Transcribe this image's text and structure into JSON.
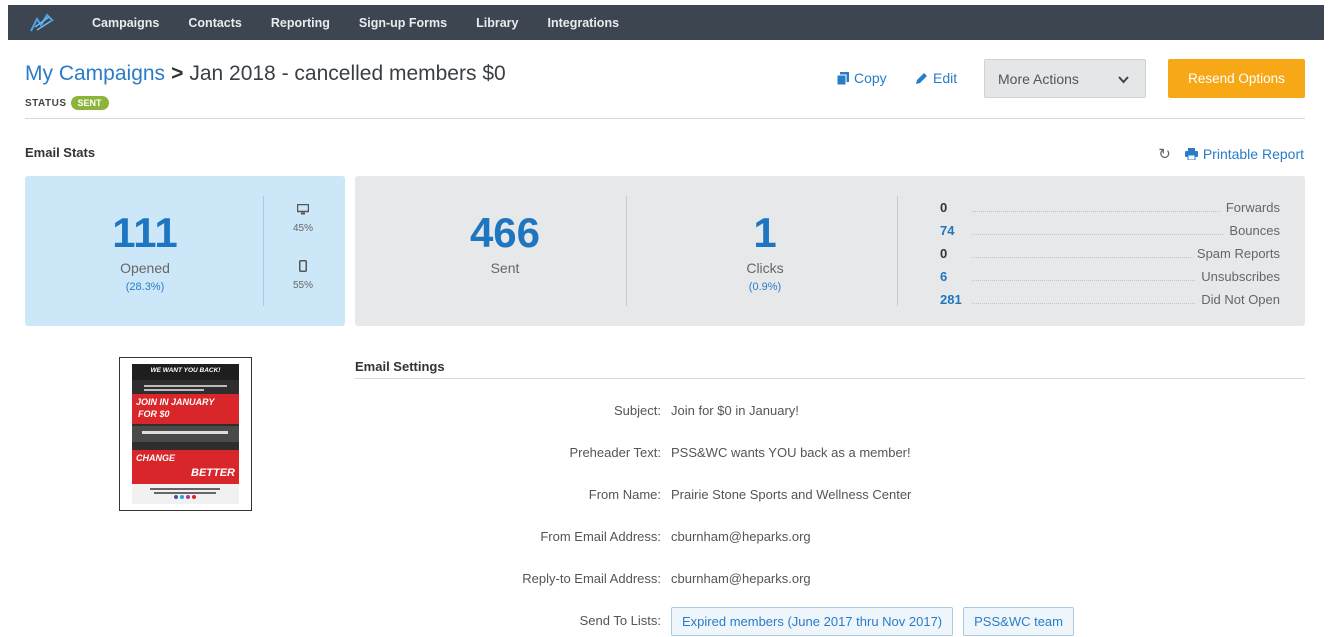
{
  "nav": {
    "items": [
      "Campaigns",
      "Contacts",
      "Reporting",
      "Sign-up Forms",
      "Library",
      "Integrations"
    ]
  },
  "header": {
    "breadcrumb": "My Campaigns",
    "separator": ">",
    "title": "Jan 2018 - cancelled members $0",
    "status_label": "STATUS",
    "status_value": "SENT",
    "copy_label": "Copy",
    "edit_label": "Edit",
    "more_actions_label": "More Actions",
    "resend_label": "Resend Options"
  },
  "stats": {
    "section_title": "Email Stats",
    "printable_label": "Printable Report",
    "opened": {
      "value": "111",
      "label": "Opened",
      "pct": "(28.3%)"
    },
    "devices": {
      "desktop_pct": "45%",
      "mobile_pct": "55%"
    },
    "sent": {
      "value": "466",
      "label": "Sent"
    },
    "clicks": {
      "value": "1",
      "label": "Clicks",
      "pct": "(0.9%)"
    },
    "breakdown": [
      {
        "value": "0",
        "label": "Forwards"
      },
      {
        "value": "74",
        "label": "Bounces"
      },
      {
        "value": "0",
        "label": "Spam Reports"
      },
      {
        "value": "6",
        "label": "Unsubscribes"
      },
      {
        "value": "281",
        "label": "Did Not Open"
      }
    ]
  },
  "thumbnail": {
    "line1": "WE WANT YOU BACK!",
    "line2": "JOIN IN JANUARY",
    "line3": "FOR $0",
    "line4": "CHANGE",
    "line5": "BETTER"
  },
  "settings": {
    "title": "Email Settings",
    "subject_key": "Subject:",
    "subject_val": "Join for $0 in January!",
    "preheader_key": "Preheader Text:",
    "preheader_val": "PSS&WC wants YOU back as a member!",
    "fromname_key": "From Name:",
    "fromname_val": "Prairie Stone Sports and Wellness Center",
    "fromemail_key": "From Email Address:",
    "fromemail_val": "cburnham@heparks.org",
    "replyto_key": "Reply-to Email Address:",
    "replyto_val": "cburnham@heparks.org",
    "lists_key": "Send To Lists:",
    "lists": [
      "Expired members (June 2017 thru Nov 2017)",
      "PSS&WC team"
    ]
  },
  "colors": {
    "nav_bg": "#3d4650",
    "accent_blue": "#2a7cc7",
    "status_green": "#8cb33a",
    "resend_orange": "#f7a816",
    "opened_panel": "#cce8f8"
  }
}
